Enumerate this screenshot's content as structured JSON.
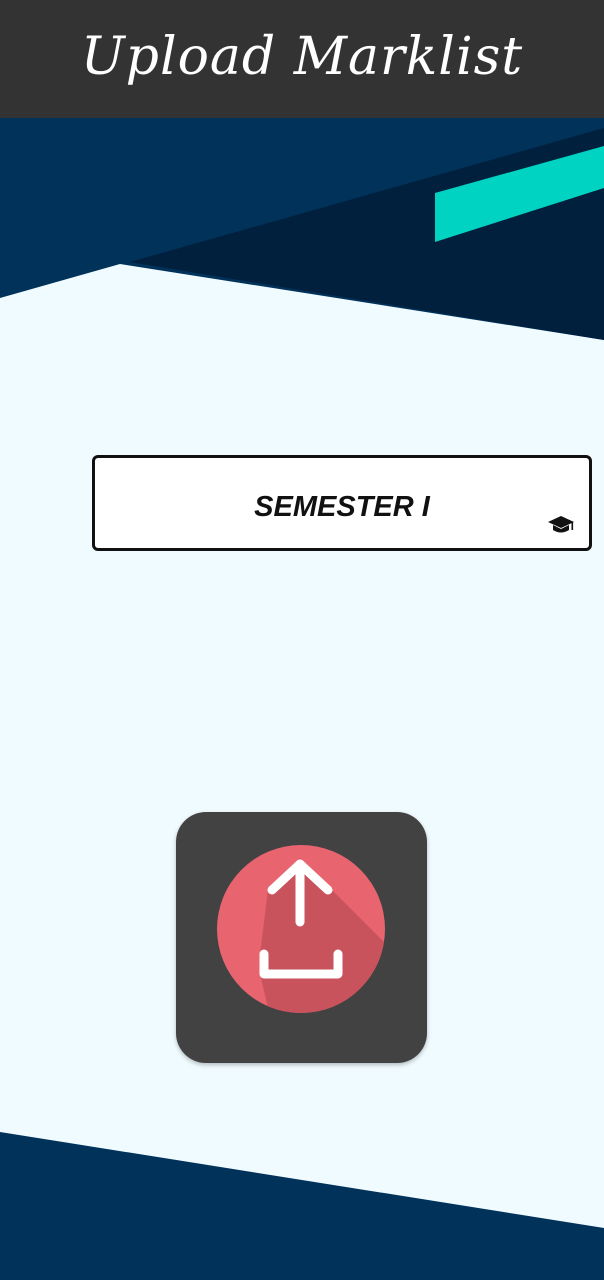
{
  "app_bar": {
    "title": "Upload Marklist"
  },
  "semester_select": {
    "selected_value": "SEMESTER I",
    "icon": "graduation-cap-icon"
  },
  "upload_button": {
    "icon": "upload-icon"
  },
  "colors": {
    "app_bar_bg": "#333333",
    "navy": "#00325a",
    "dark_navy": "#00203d",
    "teal_accent": "#00d3c2",
    "page_bg": "#f0fbff",
    "upload_tile": "#424242",
    "upload_circle": "#e8646f"
  }
}
